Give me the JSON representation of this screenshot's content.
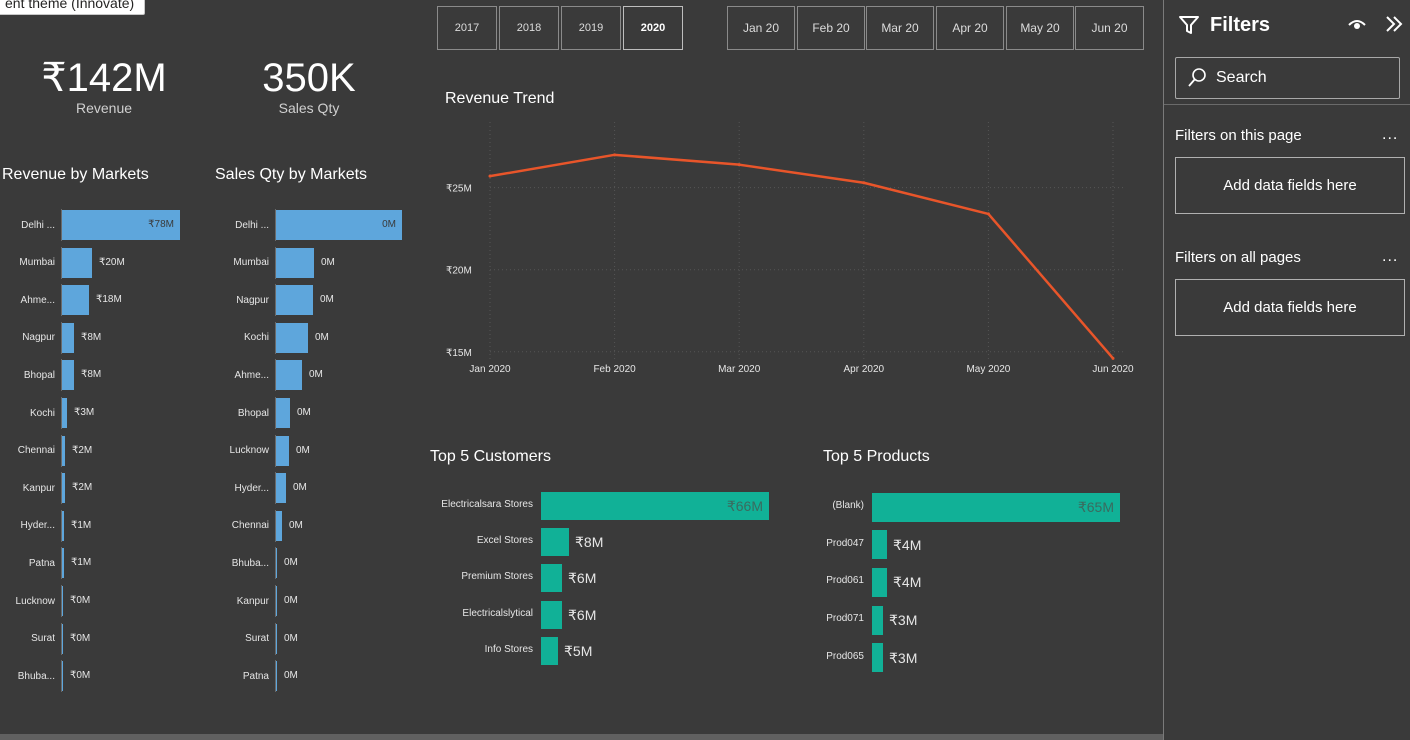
{
  "tooltip": "ent theme (Innovate)",
  "year_slicer": [
    "2017",
    "2018",
    "2019",
    "2020"
  ],
  "year_selected": "2020",
  "month_slicer": [
    "Jan 20",
    "Feb 20",
    "Mar 20",
    "Apr 20",
    "May 20",
    "Jun 20"
  ],
  "cards": {
    "revenue_value": "₹142M",
    "revenue_label": "Revenue",
    "qty_value": "350K",
    "qty_label": "Sales Qty"
  },
  "colors": {
    "accent_blue": "#5ea6dc",
    "accent_teal": "#11b197",
    "line": "#e8552a",
    "background": "#3a3a3a"
  },
  "chart_data": [
    {
      "type": "bar",
      "title": "Revenue by Markets",
      "categories": [
        "Delhi ...",
        "Mumbai",
        "Ahme...",
        "Nagpur",
        "Bhopal",
        "Kochi",
        "Chennai",
        "Kanpur",
        "Hyder...",
        "Patna",
        "Lucknow",
        "Surat",
        "Bhuba..."
      ],
      "values": [
        78,
        20,
        18,
        8,
        8,
        3,
        2,
        2,
        1,
        1,
        0,
        0,
        0
      ],
      "labels": [
        "₹78M",
        "₹20M",
        "₹18M",
        "₹8M",
        "₹8M",
        "₹3M",
        "₹2M",
        "₹2M",
        "₹1M",
        "₹1M",
        "₹0M",
        "₹0M",
        "₹0M"
      ]
    },
    {
      "type": "bar",
      "title": "Sales Qty by Markets",
      "categories": [
        "Delhi ...",
        "Mumbai",
        "Nagpur",
        "Kochi",
        "Ahme...",
        "Bhopal",
        "Lucknow",
        "Hyder...",
        "Chennai",
        "Bhuba...",
        "Kanpur",
        "Surat",
        "Patna"
      ],
      "values": [
        100,
        30,
        29,
        25,
        21,
        11,
        10,
        8,
        5,
        1,
        1,
        1,
        0.5
      ],
      "labels": [
        "0M",
        "0M",
        "0M",
        "0M",
        "0M",
        "0M",
        "0M",
        "0M",
        "0M",
        "0M",
        "0M",
        "0M",
        "0M"
      ]
    },
    {
      "type": "line",
      "title": "Revenue Trend",
      "x": [
        "Jan 2020",
        "Feb 2020",
        "Mar 2020",
        "Apr 2020",
        "May 2020",
        "Jun 2020"
      ],
      "values": [
        25.7,
        27.0,
        26.4,
        25.3,
        23.4,
        14.6
      ],
      "yticks": [
        "₹15M",
        "₹20M",
        "₹25M"
      ],
      "ytick_values": [
        15,
        20,
        25
      ],
      "ylim": [
        14.5,
        29.0
      ],
      "grid": true
    },
    {
      "type": "bar",
      "title": "Top 5 Customers",
      "categories": [
        "Electricalsara Stores",
        "Excel Stores",
        "Premium Stores",
        "Electricalslytical",
        "Info Stores"
      ],
      "values": [
        66,
        8,
        6,
        6,
        5
      ],
      "labels": [
        "₹66M",
        "₹8M",
        "₹6M",
        "₹6M",
        "₹5M"
      ]
    },
    {
      "type": "bar",
      "title": "Top 5 Products",
      "categories": [
        "(Blank)",
        "Prod047",
        "Prod061",
        "Prod071",
        "Prod065"
      ],
      "values": [
        65,
        4,
        4,
        3,
        3
      ],
      "labels": [
        "₹65M",
        "₹4M",
        "₹4M",
        "₹3M",
        "₹3M"
      ]
    }
  ],
  "filters_pane": {
    "title": "Filters",
    "search_placeholder": "Search",
    "section_this_page": "Filters on this page",
    "section_all_pages": "Filters on all pages",
    "drop_this_page": "Add data fields here",
    "drop_all_pages": "Add data fields here",
    "more": "..."
  }
}
